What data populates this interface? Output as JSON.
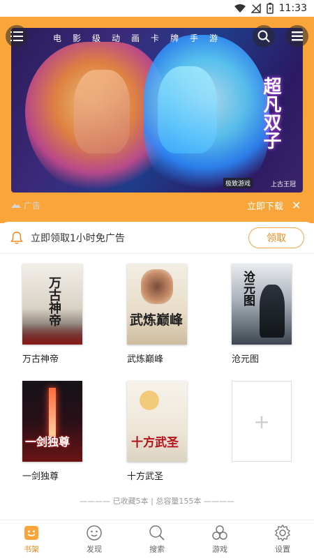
{
  "status_bar": {
    "time": "11:33"
  },
  "banner": {
    "caption": "电影级动画卡牌手游",
    "title": "超凡双子",
    "logo1": "极致游戏",
    "logo2": "上古王冠"
  },
  "ad": {
    "label": "广告",
    "download": "立即下载",
    "close": "✕"
  },
  "notice": {
    "text": "立即领取1小时免广告",
    "button": "领取"
  },
  "books": [
    {
      "title": "万古神帝",
      "cover_text": "万古神帝"
    },
    {
      "title": "武炼巅峰",
      "cover_text": "武炼巅峰"
    },
    {
      "title": "沧元图",
      "cover_text": "沧元图"
    },
    {
      "title": "一剑独尊",
      "cover_text": "一剑独尊"
    },
    {
      "title": "十方武圣",
      "cover_text": "十方武圣"
    }
  ],
  "add_book": "+",
  "summary": "———— 已收藏5本 | 总容量155本 ————",
  "tabs": [
    {
      "label": "书架",
      "icon": "bookshelf-icon",
      "active": true
    },
    {
      "label": "发现",
      "icon": "discover-icon",
      "active": false
    },
    {
      "label": "搜索",
      "icon": "search-icon",
      "active": false
    },
    {
      "label": "游戏",
      "icon": "game-icon",
      "active": false
    },
    {
      "label": "设置",
      "icon": "settings-icon",
      "active": false
    }
  ],
  "colors": {
    "accent": "#f9a53a",
    "accent_text": "#f08a1c"
  }
}
